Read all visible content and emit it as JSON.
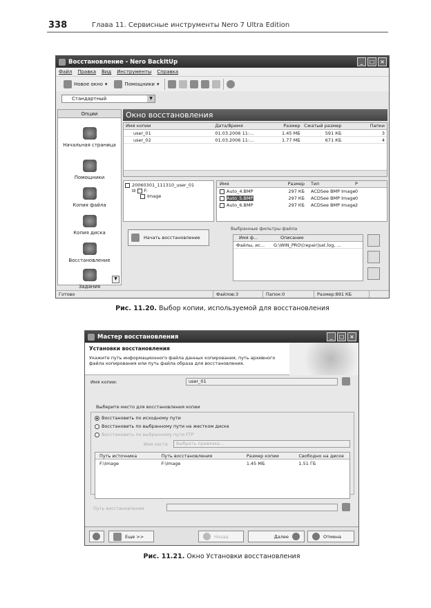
{
  "page": {
    "number": "338",
    "chapter": "Глава 11. Сервисные инструменты Nero 7 Ultra Edition",
    "caption1_label": "Рис. 11.20.",
    "caption1_text": "Выбор копии, используемой для восстановления",
    "caption2_label": "Рис. 11.21.",
    "caption2_text": "Окно Установки восстановления"
  },
  "win1": {
    "title": "Восстановление - Nero BackItUp",
    "menu": [
      "Файл",
      "Правка",
      "Вид",
      "Инструменты",
      "Справка"
    ],
    "toolbar": {
      "new_window": "Новое окно",
      "helpers": "Помощники"
    },
    "view_combo": "Стандартный",
    "sidebar_header": "Опции",
    "sidebar_items": [
      "Начальная страница",
      "Помощники",
      "Копия файла",
      "Копия диска",
      "Восстановление",
      "Задания"
    ],
    "panel_title": "Окно восстановления",
    "copies_headers": [
      "Имя копии",
      "Дата/Время",
      "Размер",
      "Сжатый размер",
      "Папки"
    ],
    "copies": [
      [
        "user_01",
        "01.03.2006 11:...",
        "1.45 МБ",
        "591 КБ",
        "3"
      ],
      [
        "user_02",
        "01.03.2006 11:...",
        "1.77 МБ",
        "671 КБ",
        "4"
      ]
    ],
    "tree": [
      "20060301_111310_user_01",
      "F:",
      "Image"
    ],
    "files_headers": [
      "Имя",
      "Размер",
      "Тип",
      "Р"
    ],
    "files": [
      [
        "Auto_4.BMP",
        "297 КБ",
        "ACDSee BMP Image",
        "0"
      ],
      [
        "Auto_5.BMP",
        "297 КБ",
        "ACDSee BMP Image",
        "0"
      ],
      [
        "Auto_6.BMP",
        "297 КБ",
        "ACDSee BMP Image",
        "2"
      ]
    ],
    "start_button": "Начать восстановление",
    "filters_label": "Выбранные фильтры файла",
    "filters_headers": [
      "Имя ф...",
      "Описание"
    ],
    "filters_row": [
      "Файлы, ис...",
      "G:\\WIN_PRO\\(repair|sat.log, ..."
    ],
    "status": {
      "ready": "Готово",
      "files": "Файлов:3",
      "folders": "Папок:0",
      "size": "Размер:891 КБ"
    }
  },
  "win2": {
    "title": "Мастер восстановления",
    "header": "Установки восстановления",
    "desc": "Укажите путь информационного файла данных копирования, путь архивного файла копирования или путь файла образа для восстановления.",
    "copy_name_label": "Имя копии:",
    "copy_name_value": "user_01",
    "group_label": "Выберите место для восстановления копии",
    "radio": [
      "Восстановить по исходному пути",
      "Восстановить по выбранному пути на жестком диске",
      "Восстановить по выбранному пути FTP"
    ],
    "host_label": "Имя хоста",
    "host_select": "Выбрать привязке...",
    "table_headers": [
      "Путь источника",
      "Путь восстановления",
      "Размер копии",
      "Свободно на диске"
    ],
    "table_row": [
      "F:\\Image",
      "F:\\Image",
      "1.45 МБ",
      "1.51 ГБ"
    ],
    "restore_path_label": "Путь восстановления",
    "buttons": {
      "more": "Еще >>",
      "back": "Назад",
      "next": "Далее",
      "cancel": "Отмена"
    }
  }
}
